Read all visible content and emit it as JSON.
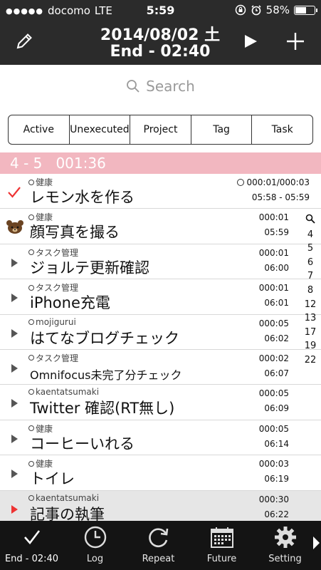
{
  "status": {
    "carrier": "docomo",
    "network": "LTE",
    "time": "5:59",
    "battery": "58%",
    "battery_level": 0.58
  },
  "header": {
    "date": "2014/08/02 土",
    "end": "End - 02:40"
  },
  "search": {
    "placeholder": "Search"
  },
  "segments": [
    "Active",
    "Unexecuted",
    "Project",
    "Tag",
    "Task"
  ],
  "section": {
    "label": "4 - 5   001:36"
  },
  "tasks": [
    {
      "category": "健康",
      "title": "レモン水を作る",
      "right_top": "000:01/000:03",
      "right_bottom": "05:58 - 05:59",
      "marker": "check"
    },
    {
      "category": "健康",
      "title": "顔写真を撮る",
      "right_top": "000:01",
      "right_bottom": "05:59",
      "marker": "bear"
    },
    {
      "category": "タスク管理",
      "title": "ジョルテ更新確認",
      "right_top": "000:01",
      "right_bottom": "06:00",
      "marker": "play"
    },
    {
      "category": "タスク管理",
      "title": "iPhone充電",
      "right_top": "000:01",
      "right_bottom": "06:01",
      "marker": "play"
    },
    {
      "category": "mojigurui",
      "title": "はてなブログチェック",
      "right_top": "000:05",
      "right_bottom": "06:02",
      "marker": "play"
    },
    {
      "category": "タスク管理",
      "title": "Omnifocus未完了分チェック",
      "right_top": "000:02",
      "right_bottom": "06:07",
      "marker": "play"
    },
    {
      "category": "kaentatsumaki",
      "title": "Twitter 確認(RT無し)",
      "right_top": "000:05",
      "right_bottom": "06:09",
      "marker": "play"
    },
    {
      "category": "健康",
      "title": "コーヒーいれる",
      "right_top": "000:05",
      "right_bottom": "06:14",
      "marker": "play"
    },
    {
      "category": "健康",
      "title": "トイレ",
      "right_top": "000:03",
      "right_bottom": "06:19",
      "marker": "play"
    },
    {
      "category": "kaentatsumaki",
      "title": "記事の執筆",
      "right_top": "000:30",
      "right_bottom": "06:22",
      "marker": "play-red"
    }
  ],
  "index": [
    "4",
    "5",
    "6",
    "7",
    "8",
    "12",
    "13",
    "17",
    "19",
    "22"
  ],
  "tabs": [
    {
      "label": "End - 02:40",
      "icon": "check-icon"
    },
    {
      "label": "Log",
      "icon": "clock-icon"
    },
    {
      "label": "Repeat",
      "icon": "repeat-icon"
    },
    {
      "label": "Future",
      "icon": "calendar-icon"
    },
    {
      "label": "Setting",
      "icon": "gear-icon"
    }
  ],
  "colors": {
    "header_bg": "#2b2b2b",
    "section_bg": "#f2b7c0",
    "check": "#ee3333",
    "tabbar_bg": "#141414"
  }
}
